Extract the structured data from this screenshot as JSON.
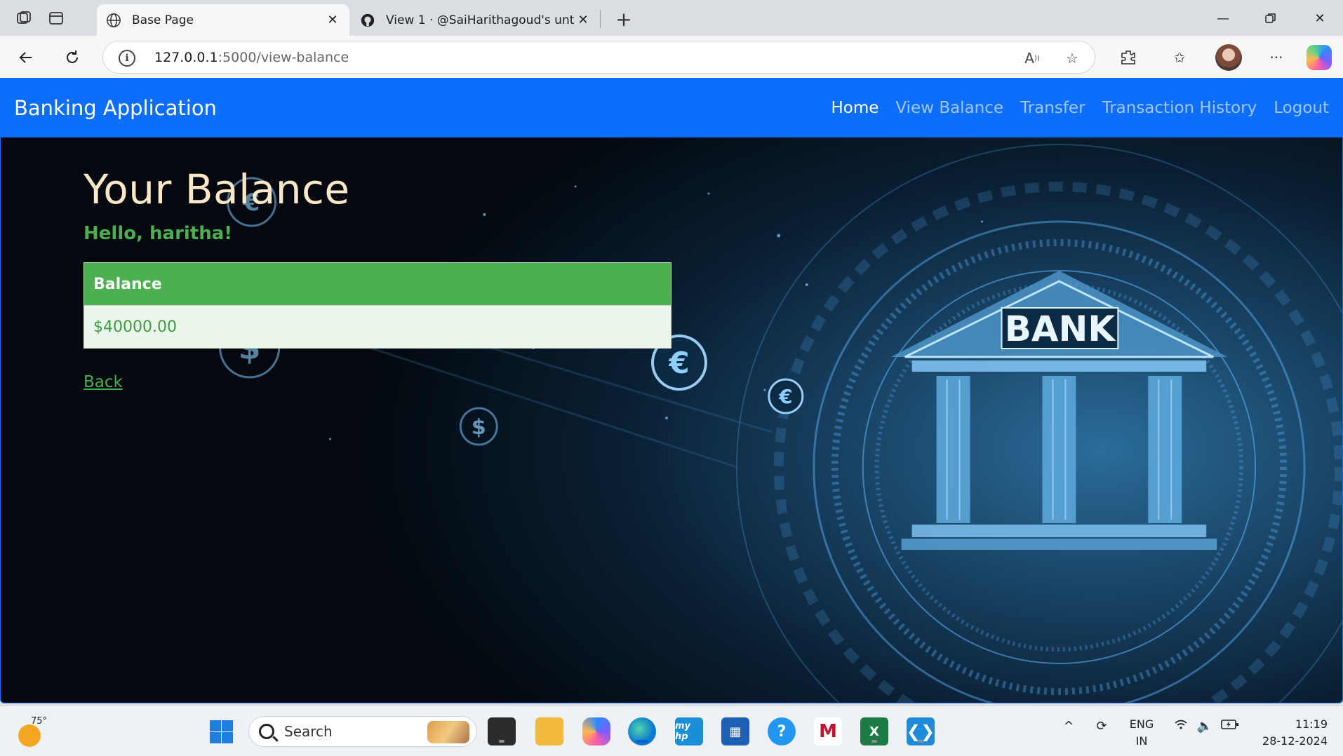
{
  "browser": {
    "tabs": [
      {
        "title": "Base Page",
        "icon": "globe-icon",
        "active": true
      },
      {
        "title": "View 1 · @SaiHarithagoud's untitl",
        "icon": "github-icon",
        "active": false
      }
    ],
    "url_host": "127.0.0.1",
    "url_path": ":5000/view-balance"
  },
  "page": {
    "navbar": {
      "brand": "Banking Application",
      "links": [
        "Home",
        "View Balance",
        "Transfer",
        "Transaction History",
        "Logout"
      ],
      "active_link": "Home"
    },
    "title": "Your Balance",
    "greeting": "Hello, haritha!",
    "table": {
      "header": "Balance",
      "value": "$40000.00"
    },
    "back_link": "Back",
    "background_sign": "BANK",
    "colors": {
      "navbar": "#0d6efd",
      "accent_green": "#4caf50",
      "title": "#fde7c6"
    }
  },
  "taskbar": {
    "weather_temp": "75°",
    "search_label": "Search",
    "language_line1": "ENG",
    "language_line2": "IN",
    "time": "11:19",
    "date": "28-12-2024"
  }
}
